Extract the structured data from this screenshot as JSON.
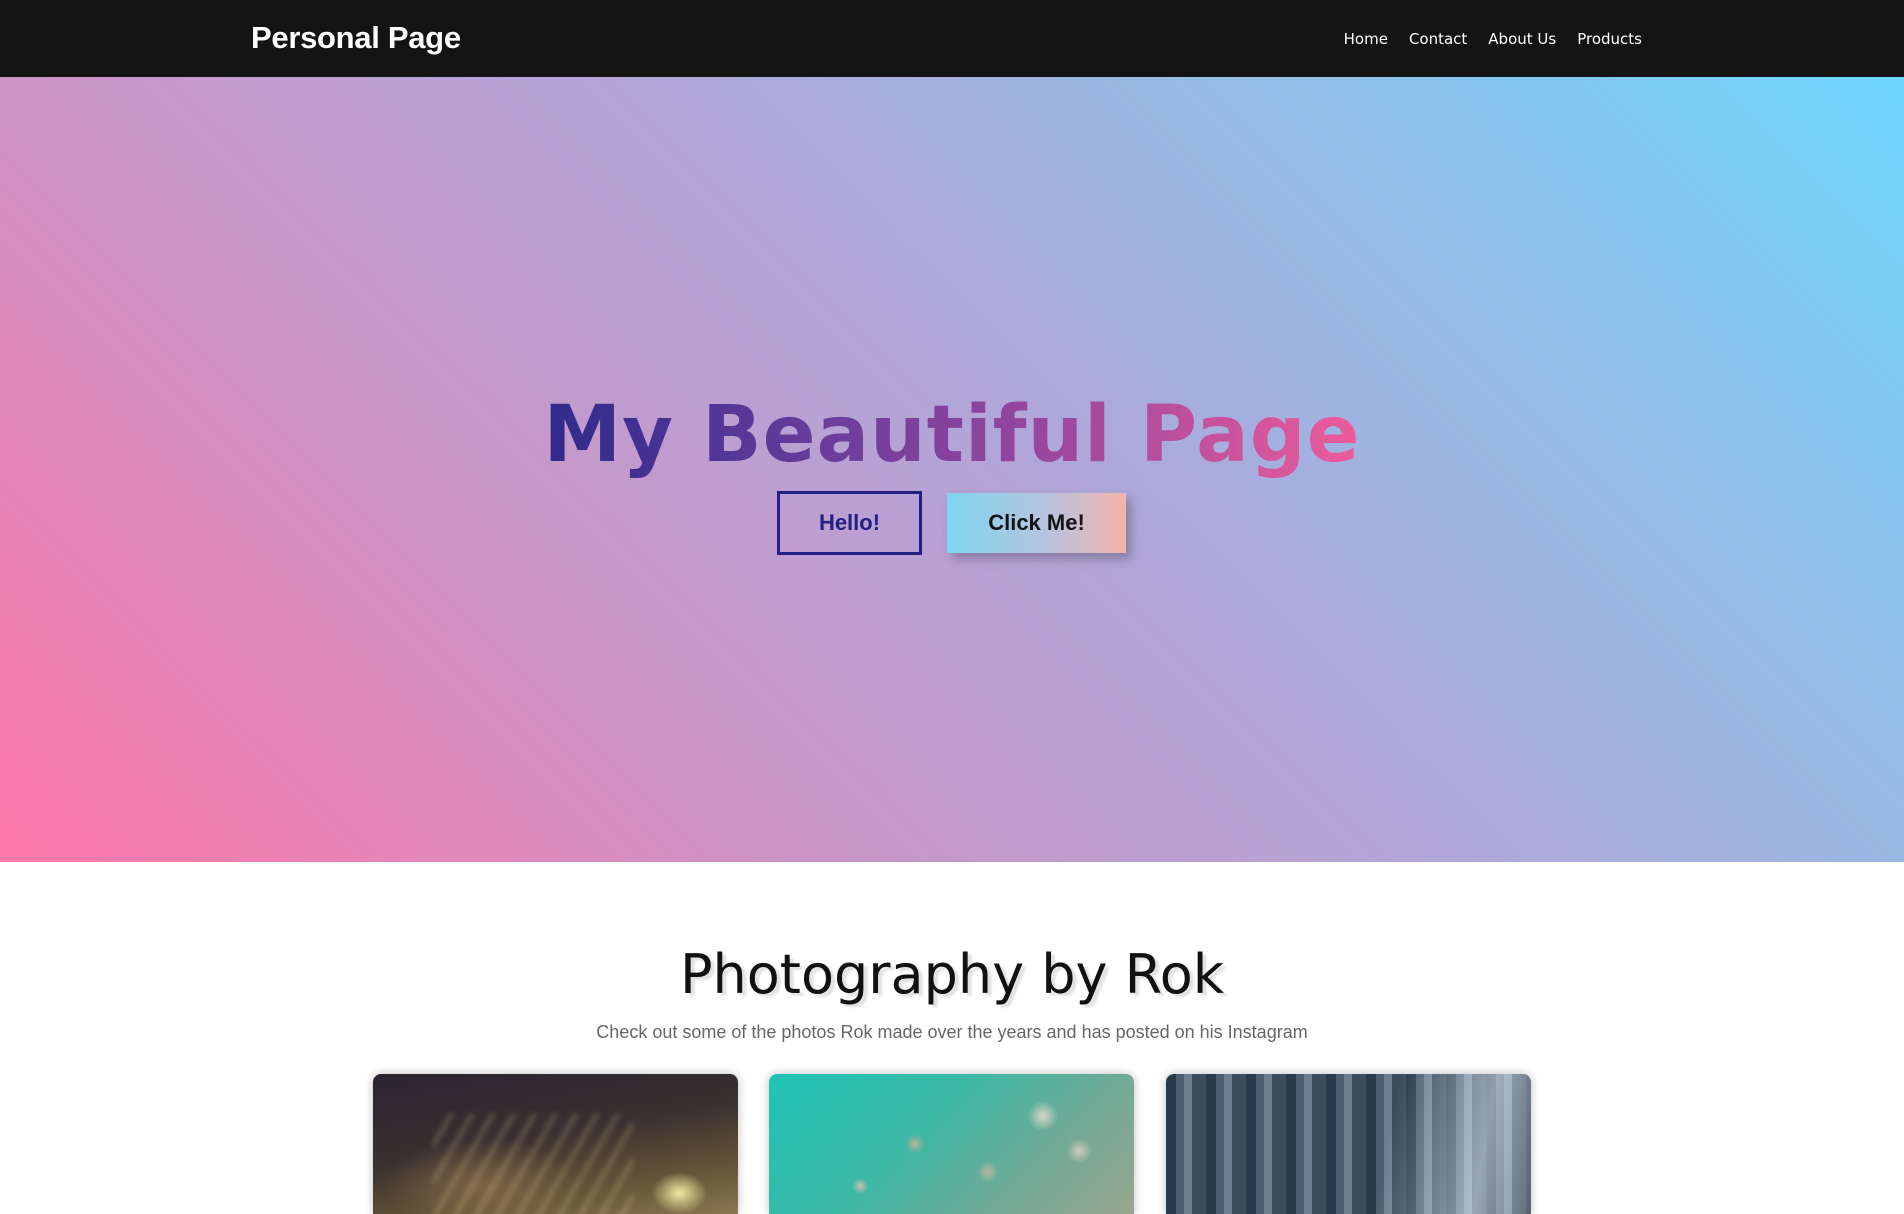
{
  "navbar": {
    "brand": "Personal Page",
    "links": [
      {
        "label": "Home"
      },
      {
        "label": "Contact"
      },
      {
        "label": "About Us"
      },
      {
        "label": "Products"
      }
    ]
  },
  "hero": {
    "title": "My Beautiful Page",
    "hello_button": "Hello!",
    "click_button": "Click Me!"
  },
  "photography": {
    "title": "Photography by Rok",
    "subtitle": "Check out some of the photos Rok made over the years and has posted on his Instagram",
    "photos": [
      {
        "subject": "night-street-lights"
      },
      {
        "subject": "aerial-rocky-turquoise-shore"
      },
      {
        "subject": "sunlit-forest"
      }
    ]
  },
  "colors": {
    "navbar_bg": "#141414",
    "hero_gradient_start": "#ff77a8",
    "hero_gradient_end": "#6ed6fd",
    "hello_button_border": "#221f85"
  }
}
